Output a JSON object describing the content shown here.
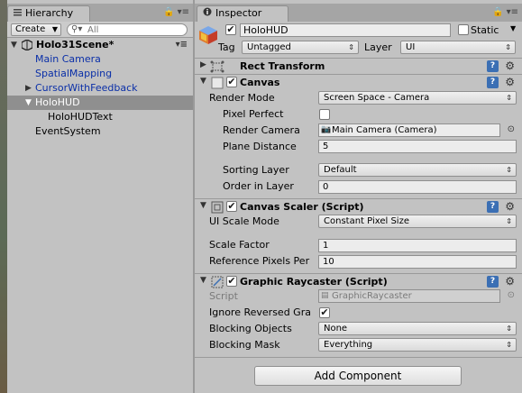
{
  "hierarchy": {
    "tab_label": "Hierarchy",
    "create_label": "Create",
    "search_placeholder": "All",
    "scene_name": "Holo31Scene*",
    "items": [
      {
        "label": "Main Camera",
        "color": "#0a2fa8"
      },
      {
        "label": "SpatialMapping",
        "color": "#0a2fa8"
      },
      {
        "label": "CursorWithFeedback",
        "color": "#0a2fa8"
      },
      {
        "label": "HoloHUD",
        "selected": true
      },
      {
        "label": "HoloHUDText"
      },
      {
        "label": "EventSystem"
      }
    ]
  },
  "inspector": {
    "tab_label": "Inspector",
    "object_name": "HoloHUD",
    "static_label": "Static",
    "tag_label": "Tag",
    "tag_value": "Untagged",
    "layer_label": "Layer",
    "layer_value": "UI",
    "rect_transform": {
      "title": "Rect Transform"
    },
    "canvas": {
      "title": "Canvas",
      "render_mode_label": "Render Mode",
      "render_mode_value": "Screen Space - Camera",
      "pixel_perfect_label": "Pixel Perfect",
      "render_camera_label": "Render Camera",
      "render_camera_value": "Main Camera (Camera)",
      "plane_distance_label": "Plane Distance",
      "plane_distance_value": "5",
      "sorting_layer_label": "Sorting Layer",
      "sorting_layer_value": "Default",
      "order_in_layer_label": "Order in Layer",
      "order_in_layer_value": "0"
    },
    "canvas_scaler": {
      "title": "Canvas Scaler (Script)",
      "ui_scale_mode_label": "UI Scale Mode",
      "ui_scale_mode_value": "Constant Pixel Size",
      "scale_factor_label": "Scale Factor",
      "scale_factor_value": "1",
      "ref_pixels_label": "Reference Pixels Per",
      "ref_pixels_value": "10"
    },
    "graphic_raycaster": {
      "title": "Graphic Raycaster (Script)",
      "script_label": "Script",
      "script_value": "GraphicRaycaster",
      "ignore_reversed_label": "Ignore Reversed Gra",
      "blocking_objects_label": "Blocking Objects",
      "blocking_objects_value": "None",
      "blocking_mask_label": "Blocking Mask",
      "blocking_mask_value": "Everything"
    },
    "add_component_label": "Add Component"
  }
}
